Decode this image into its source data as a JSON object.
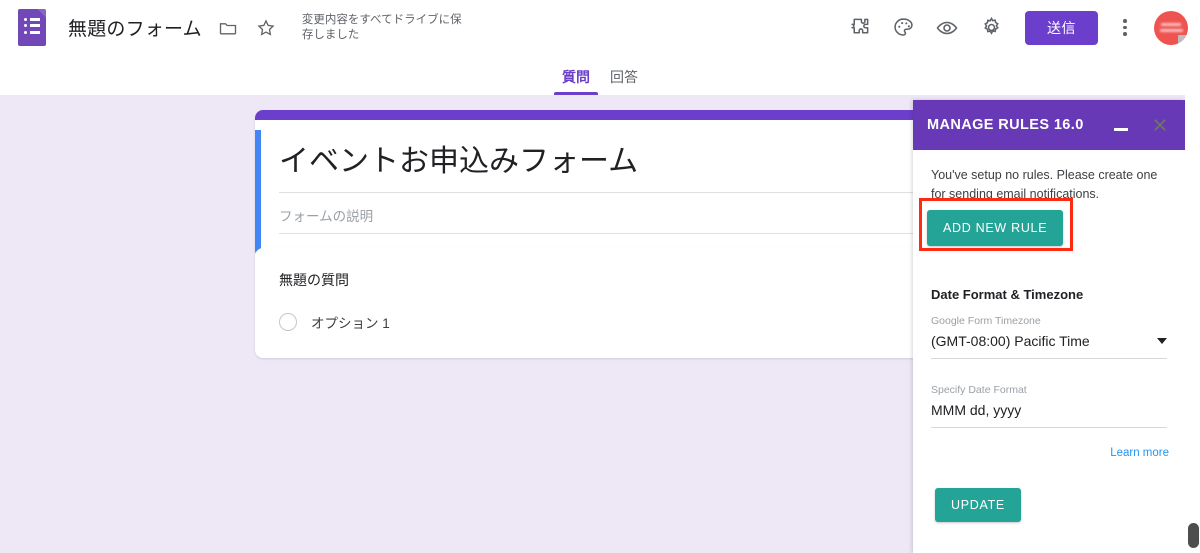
{
  "topbar": {
    "logo_icon": "google-forms-icon",
    "doc_title": "無題のフォーム",
    "folder_icon": "folder-icon",
    "star_icon": "star-icon",
    "save_status": "変更内容をすべてドライブに保存しました",
    "addons_icon": "puzzle-piece-icon",
    "theme_icon": "palette-icon",
    "preview_icon": "eye-icon",
    "settings_icon": "gear-icon",
    "send_label": "送信",
    "more_icon": "kebab-menu-icon",
    "avatar_icon": "user-avatar"
  },
  "tabs": [
    {
      "label": "質問",
      "active": true
    },
    {
      "label": "回答",
      "active": false
    }
  ],
  "form": {
    "title": "イベントお申込みフォーム",
    "description_placeholder": "フォームの説明",
    "question": {
      "title": "無題の質問",
      "options": [
        {
          "label": "オプション 1"
        }
      ]
    }
  },
  "panel": {
    "title": "MANAGE RULES 16.0",
    "minimize_icon": "minimize-icon",
    "close_icon": "close-icon",
    "message": "You've setup no rules. Please create one for sending email notifications.",
    "add_new_rule_label": "ADD NEW RULE",
    "section_title": "Date Format & Timezone",
    "timezone_label": "Google Form Timezone",
    "timezone_value": "(GMT-08:00) Pacific Time",
    "date_format_label": "Specify Date Format",
    "date_format_value": "MMM dd, yyyy",
    "learn_more_label": "Learn more",
    "update_label": "UPDATE"
  },
  "colors": {
    "forms_purple": "#6B3FCB",
    "panel_purple": "#6739B7",
    "teal": "#24A497",
    "annotation_red": "#FF2A12",
    "canvas_bg": "#EDE7F6",
    "link_blue": "#2196F3",
    "card_accent_blue": "#4285F4"
  }
}
